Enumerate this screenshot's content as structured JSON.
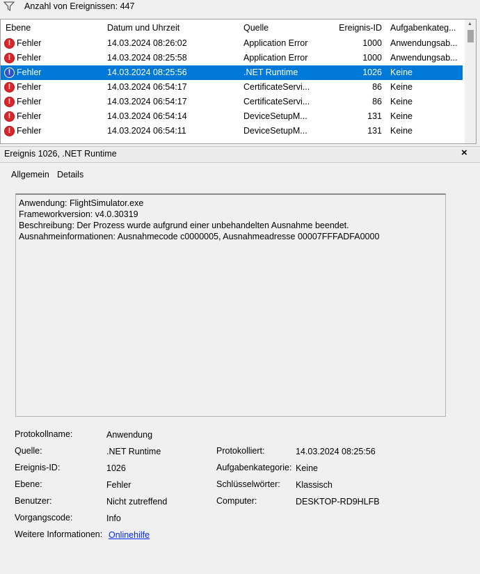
{
  "toolbar": {
    "event_count_label": "Anzahl von Ereignissen: 447"
  },
  "list": {
    "headers": {
      "level": "Ebene",
      "date": "Datum und Uhrzeit",
      "source": "Quelle",
      "event_id": "Ereignis-ID",
      "task_category": "Aufgabenkateg..."
    },
    "rows": [
      {
        "level": "Fehler",
        "date": "14.03.2024 08:26:02",
        "source": "Application Error",
        "event_id": "1000",
        "task_category": "Anwendungsab...",
        "selected": false
      },
      {
        "level": "Fehler",
        "date": "14.03.2024 08:25:58",
        "source": "Application Error",
        "event_id": "1000",
        "task_category": "Anwendungsab...",
        "selected": false
      },
      {
        "level": "Fehler",
        "date": "14.03.2024 08:25:56",
        "source": ".NET Runtime",
        "event_id": "1026",
        "task_category": "Keine",
        "selected": true
      },
      {
        "level": "Fehler",
        "date": "14.03.2024 06:54:17",
        "source": "CertificateServi...",
        "event_id": "86",
        "task_category": "Keine",
        "selected": false
      },
      {
        "level": "Fehler",
        "date": "14.03.2024 06:54:17",
        "source": "CertificateServi...",
        "event_id": "86",
        "task_category": "Keine",
        "selected": false
      },
      {
        "level": "Fehler",
        "date": "14.03.2024 06:54:14",
        "source": "DeviceSetupM...",
        "event_id": "131",
        "task_category": "Keine",
        "selected": false
      },
      {
        "level": "Fehler",
        "date": "14.03.2024 06:54:11",
        "source": "DeviceSetupM...",
        "event_id": "131",
        "task_category": "Keine",
        "selected": false
      }
    ]
  },
  "detail": {
    "title": "Ereignis 1026, .NET Runtime",
    "close_glyph": "×",
    "tabs": {
      "general": "Allgemein",
      "details": "Details"
    },
    "message_lines": [
      "Anwendung: FlightSimulator.exe",
      "Frameworkversion: v4.0.30319",
      "Beschreibung: Der Prozess wurde aufgrund einer unbehandelten Ausnahme beendet.",
      "Ausnahmeinformationen: Ausnahmecode c0000005, Ausnahmeadresse 00007FFFADFA0000"
    ],
    "fields": {
      "log_name_label": "Protokollname:",
      "log_name": "Anwendung",
      "source_label": "Quelle:",
      "source": ".NET Runtime",
      "logged_label": "Protokolliert:",
      "logged": "14.03.2024 08:25:56",
      "event_id_label": "Ereignis-ID:",
      "event_id": "1026",
      "task_category_label": "Aufgabenkategorie:",
      "task_category": "Keine",
      "level_label": "Ebene:",
      "level": "Fehler",
      "keywords_label": "Schlüsselwörter:",
      "keywords": "Klassisch",
      "user_label": "Benutzer:",
      "user": "Nicht zutreffend",
      "computer_label": "Computer:",
      "computer": "DESKTOP-RD9HLFB",
      "opcode_label": "Vorgangscode:",
      "opcode": "Info",
      "more_info_label": "Weitere Informationen:",
      "more_info_link": "Onlinehilfe"
    }
  },
  "colors": {
    "selection": "#0078d7",
    "error": "#d9262a",
    "info": "#2c54c8",
    "link": "#0026ff"
  }
}
